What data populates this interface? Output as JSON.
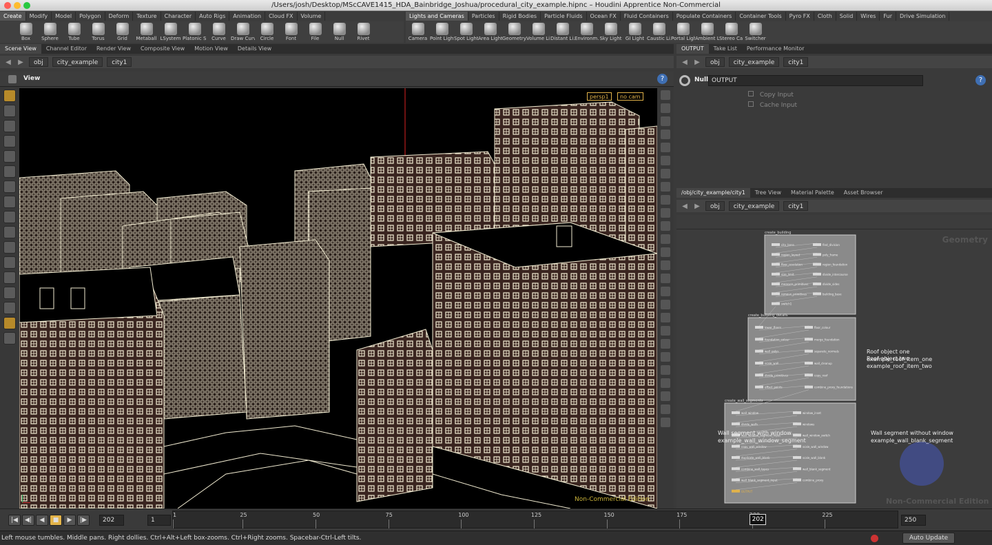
{
  "window": {
    "title": "/Users/josh/Desktop/MScCAVE1415_HDA_Bainbridge_Joshua/procedural_city_example.hipnc – Houdini Apprentice Non-Commercial"
  },
  "shelf_left": {
    "tabs": [
      "Create",
      "Modify",
      "Model",
      "Polygon",
      "Deform",
      "Texture",
      "Character",
      "Auto Rigs",
      "Animation",
      "Cloud FX",
      "Volume"
    ],
    "tools": [
      "Box",
      "Sphere",
      "Tube",
      "Torus",
      "Grid",
      "Metaball",
      "LSystem",
      "Platonic S...",
      "Curve",
      "Draw Curve",
      "Circle",
      "Font",
      "File",
      "Null",
      "Rivet"
    ]
  },
  "shelf_right": {
    "tabs": [
      "Lights and Cameras",
      "Particles",
      "Rigid Bodies",
      "Particle Fluids",
      "Ocean FX",
      "Fluid Containers",
      "Populate Containers",
      "Container Tools",
      "Pyro FX",
      "Cloth",
      "Solid",
      "Wires",
      "Fur",
      "Drive Simulation"
    ],
    "tools": [
      "Camera",
      "Point Light",
      "Spot Light",
      "Area Light",
      "Geometry...",
      "Volume Li...",
      "Distant Li...",
      "Environm...",
      "Sky Light",
      "GI Light",
      "Caustic Li...",
      "Portal Light",
      "Ambient L...",
      "Stereo Ca...",
      "Switcher"
    ]
  },
  "left_pane": {
    "tabs": [
      "Scene View",
      "Channel Editor",
      "Render View",
      "Composite View",
      "Motion View",
      "Details View"
    ],
    "path": [
      "obj",
      "city_example",
      "city1"
    ],
    "view_label": "View",
    "camera_menu": "persp1",
    "cam_menu": "no cam",
    "watermark": "Non-Commercial Edition"
  },
  "right_top_pane": {
    "tabs": [
      "OUTPUT",
      "Take List",
      "Performance Monitor"
    ],
    "path": [
      "obj",
      "city_example",
      "city1"
    ],
    "node_type": "Null",
    "node_name": "OUTPUT",
    "checkboxes": [
      "Copy Input",
      "Cache Input"
    ]
  },
  "right_bottom_pane": {
    "tabs": [
      "/obj/city_example/city1",
      "Tree View",
      "Material Palette",
      "Asset Browser"
    ],
    "path": [
      "obj",
      "city_example",
      "city1"
    ],
    "context_label": "Geometry",
    "watermark": "Non-Commercial Edition",
    "boxes": [
      {
        "title": "create_building"
      },
      {
        "title": "create_building_details"
      },
      {
        "title": "create_wall_segments"
      }
    ],
    "nodes": [
      "city_base",
      "find_division",
      "region_layout",
      "poly_frame",
      "floor_resolution",
      "region_foundation",
      "size_limit",
      "divide_intercourse",
      "measure_primitives",
      "divide_sides",
      "remove_primitives",
      "building_base",
      "switch1",
      "lower_floors",
      "floor_colour",
      "foundation_colour",
      "merge_foundation",
      "wall_polys",
      "separate_normals",
      "scale_wall",
      "wall_cleanup",
      "divide_primitives",
      "copy_roof",
      "offset_points",
      "combine_proxy_foundations",
      "wall_window",
      "window_inset",
      "divide_walls",
      "windows",
      "wall_window_segment_input",
      "wall_window_switch",
      "copy_wall_window",
      "scale_wall_window",
      "duplicate_wall_blank",
      "scale_wall_blank",
      "combine_wall_types",
      "wall_blank_segment",
      "wall_blank_segment_input",
      "combine_proxy",
      "OUTPUT"
    ],
    "notes": [
      {
        "title": "Roof object one",
        "sub": "example_roof_item_one"
      },
      {
        "title": "Roof object two",
        "sub": "example_roof_item_two"
      },
      {
        "title": "Wall segment with window",
        "sub": "example_wall_window_segment"
      },
      {
        "title": "Wall segment without window",
        "sub": "example_wall_blank_segment"
      }
    ]
  },
  "timeline": {
    "current_frame": "202",
    "start_frame": "1",
    "end_frame": "250",
    "ticks": [
      "1",
      "25",
      "50",
      "75",
      "100",
      "125",
      "150",
      "175",
      "200",
      "225"
    ],
    "playhead_label": "202"
  },
  "status": {
    "message": "Left mouse tumbles. Middle pans. Right dollies. Ctrl+Alt+Left box-zooms. Ctrl+Right zooms. Spacebar-Ctrl-Left tilts.",
    "update_mode": "Auto Update"
  },
  "colors": {
    "accent": "#e2b34a",
    "viewport_bg": "#000000",
    "wire": "#f2ecd2",
    "facade": "#3a2520"
  }
}
